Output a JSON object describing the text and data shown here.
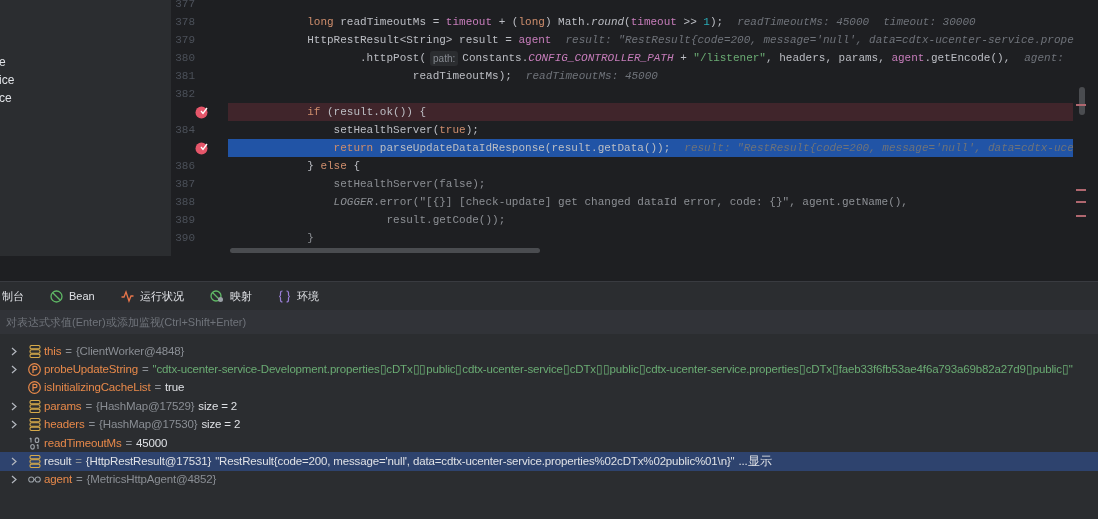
{
  "left_panel": {
    "items": [
      "e",
      "ice",
      "ce"
    ]
  },
  "editor": {
    "lines": [
      {
        "number": "377",
        "breakpoint": false,
        "kind": "plain"
      },
      {
        "number": "378",
        "breakpoint": false,
        "kind": "plain",
        "dimmed": false,
        "tokens": [
          {
            "kind": "keyword",
            "text": "            long"
          },
          {
            "kind": "plain",
            "text": " readTimeoutMs = "
          },
          {
            "kind": "field",
            "text": "timeout"
          },
          {
            "kind": "plain",
            "text": " + ("
          },
          {
            "kind": "keyword",
            "text": "long"
          },
          {
            "kind": "plain",
            "text": ") Math."
          },
          {
            "kind": "static",
            "text": "round"
          },
          {
            "kind": "plain",
            "text": "("
          },
          {
            "kind": "field",
            "text": "timeout"
          },
          {
            "kind": "plain",
            "text": " >> "
          },
          {
            "kind": "number",
            "text": "1"
          },
          {
            "kind": "plain",
            "text": ");"
          },
          {
            "kind": "hint",
            "text": "readTimeoutMs: 45000"
          },
          {
            "kind": "hint",
            "text": "timeout: 30000"
          }
        ]
      },
      {
        "number": "379",
        "breakpoint": false,
        "kind": "plain",
        "dimmed": false,
        "tokens": [
          {
            "kind": "plain",
            "text": "            HttpRestResult<String> result = "
          },
          {
            "kind": "field",
            "text": "agent"
          },
          {
            "kind": "hint",
            "text": "result: \"RestResult{code=200, message='null', data=cdtx-ucenter-service.prope"
          }
        ]
      },
      {
        "number": "380",
        "breakpoint": false,
        "kind": "plain",
        "dimmed": false,
        "tokens": [
          {
            "kind": "plain",
            "text": "                    .httpPost("
          },
          {
            "kind": "param",
            "text": "path:"
          },
          {
            "kind": "plain",
            "text": "Constants."
          },
          {
            "kind": "constant",
            "text": "CONFIG_CONTROLLER_PATH"
          },
          {
            "kind": "plain",
            "text": " + "
          },
          {
            "kind": "string",
            "text": "\"/listener\""
          },
          {
            "kind": "plain",
            "text": ", headers, params, "
          },
          {
            "kind": "field",
            "text": "agent"
          },
          {
            "kind": "plain",
            "text": ".getEncode(),"
          },
          {
            "kind": "hint",
            "text": "agent:"
          }
        ]
      },
      {
        "number": "381",
        "breakpoint": false,
        "kind": "plain",
        "dimmed": false,
        "tokens": [
          {
            "kind": "plain",
            "text": "                            readTimeoutMs);"
          },
          {
            "kind": "hint",
            "text": "readTimeoutMs: 45000"
          }
        ]
      },
      {
        "number": "382",
        "breakpoint": false,
        "kind": "plain"
      },
      {
        "breakpoint": true,
        "kind": "breakpoint",
        "dimmed": false,
        "tokens": [
          {
            "kind": "keyword",
            "text": "            if"
          },
          {
            "kind": "plain",
            "text": " (result.ok()) {"
          }
        ]
      },
      {
        "number": "384",
        "breakpoint": false,
        "kind": "plain",
        "dimmed": false,
        "tokens": [
          {
            "kind": "plain",
            "text": "                setHealthServer("
          },
          {
            "kind": "keyword",
            "text": "true"
          },
          {
            "kind": "plain",
            "text": ");"
          }
        ]
      },
      {
        "breakpoint": true,
        "kind": "execution",
        "dimmed": false,
        "tokens": [
          {
            "kind": "keyword",
            "text": "                return"
          },
          {
            "kind": "plain",
            "text": " parseUpdateDataIdResponse(result.getData());"
          },
          {
            "kind": "hint",
            "text": "result: \"RestResult{code=200, message='null', data=cdtx-uce"
          }
        ]
      },
      {
        "number": "386",
        "breakpoint": false,
        "kind": "plain",
        "dimmed": false,
        "tokens": [
          {
            "kind": "plain",
            "text": "            } "
          },
          {
            "kind": "keyword",
            "text": "else"
          },
          {
            "kind": "plain",
            "text": " {"
          }
        ]
      },
      {
        "number": "387",
        "breakpoint": false,
        "kind": "plain",
        "dimmed": true,
        "tokens": [
          {
            "kind": "plain",
            "text": "                setHealthServer("
          },
          {
            "kind": "keyword",
            "text": "false"
          },
          {
            "kind": "plain",
            "text": ");"
          }
        ]
      },
      {
        "number": "388",
        "breakpoint": false,
        "kind": "plain",
        "dimmed": true,
        "tokens": [
          {
            "kind": "constant",
            "text": "                LOGGER"
          },
          {
            "kind": "plain",
            "text": ".error("
          },
          {
            "kind": "string",
            "text": "\"[{}] [check-update] get changed dataId error, code: {}\""
          },
          {
            "kind": "plain",
            "text": ", agent.getName(),"
          }
        ]
      },
      {
        "number": "389",
        "breakpoint": false,
        "kind": "plain",
        "dimmed": true,
        "tokens": [
          {
            "kind": "plain",
            "text": "                        result.getCode());"
          }
        ]
      },
      {
        "number": "390",
        "breakpoint": false,
        "kind": "plain",
        "dimmed": true,
        "tokens": [
          {
            "kind": "plain",
            "text": "            }"
          }
        ]
      }
    ]
  },
  "debug_panel": {
    "tabs": [
      {
        "label": "制台",
        "selected": false
      },
      {
        "label": "Bean",
        "selected": false
      },
      {
        "label": "运行状况",
        "selected": false
      },
      {
        "label": "映射",
        "selected": false
      },
      {
        "label": "环境",
        "selected": false
      }
    ],
    "expression_field": {
      "placeholder": "对表达式求值(Enter)或添加监视(Ctrl+Shift+Enter)"
    },
    "variables": [
      {
        "expandable": true,
        "kind": "object",
        "name": "this",
        "selected": false,
        "value": [
          {
            "kind": "op",
            "text": "="
          },
          {
            "kind": "ref",
            "text": "{ClientWorker@4848}"
          }
        ]
      },
      {
        "expandable": true,
        "kind": "protected",
        "name": "probeUpdateString",
        "selected": false,
        "value": [
          {
            "kind": "op",
            "text": "="
          },
          {
            "kind": "string",
            "text": "\"cdtx-ucenter-service-Development.properties▯cDTx▯▯public▯cdtx-ucenter-service▯cDTx▯▯public▯cdtx-ucenter-service.properties▯cDTx▯faeb33f6fb53ae4f6a793a69b82a27d9▯public▯\""
          }
        ]
      },
      {
        "expandable": false,
        "kind": "protected",
        "name": "isInitializingCacheList",
        "selected": false,
        "value": [
          {
            "kind": "op",
            "text": "="
          },
          {
            "kind": "plain",
            "text": "true"
          }
        ]
      },
      {
        "expandable": true,
        "kind": "object",
        "name": "params",
        "selected": false,
        "value": [
          {
            "kind": "op",
            "text": "="
          },
          {
            "kind": "ref",
            "text": "{HashMap@17529}"
          },
          {
            "kind": "plain",
            "text": "size = 2"
          }
        ]
      },
      {
        "expandable": true,
        "kind": "object",
        "name": "headers",
        "selected": false,
        "value": [
          {
            "kind": "op",
            "text": "="
          },
          {
            "kind": "ref",
            "text": "{HashMap@17530}"
          },
          {
            "kind": "plain",
            "text": "size = 2"
          }
        ]
      },
      {
        "expandable": false,
        "kind": "primitive",
        "name": "readTimeoutMs",
        "selected": false,
        "value": [
          {
            "kind": "op",
            "text": "="
          },
          {
            "kind": "plain",
            "text": "45000"
          }
        ]
      },
      {
        "expandable": true,
        "kind": "object",
        "name": "result",
        "selected": true,
        "value": [
          {
            "kind": "op",
            "text": "="
          },
          {
            "kind": "ref",
            "text": "{HttpRestResult@17531}"
          },
          {
            "kind": "plain",
            "text": "\"RestResult{code=200, message='null', data=cdtx-ucenter-service.properties%02cDTx%02public%01\\n}\""
          },
          {
            "kind": "link",
            "text": "...显示"
          }
        ]
      },
      {
        "expandable": true,
        "kind": "watch",
        "name": "agent",
        "selected": false,
        "value": [
          {
            "kind": "op",
            "text": "="
          },
          {
            "kind": "ref",
            "text": "{MetricsHttpAgent@4852}"
          }
        ]
      }
    ]
  }
}
